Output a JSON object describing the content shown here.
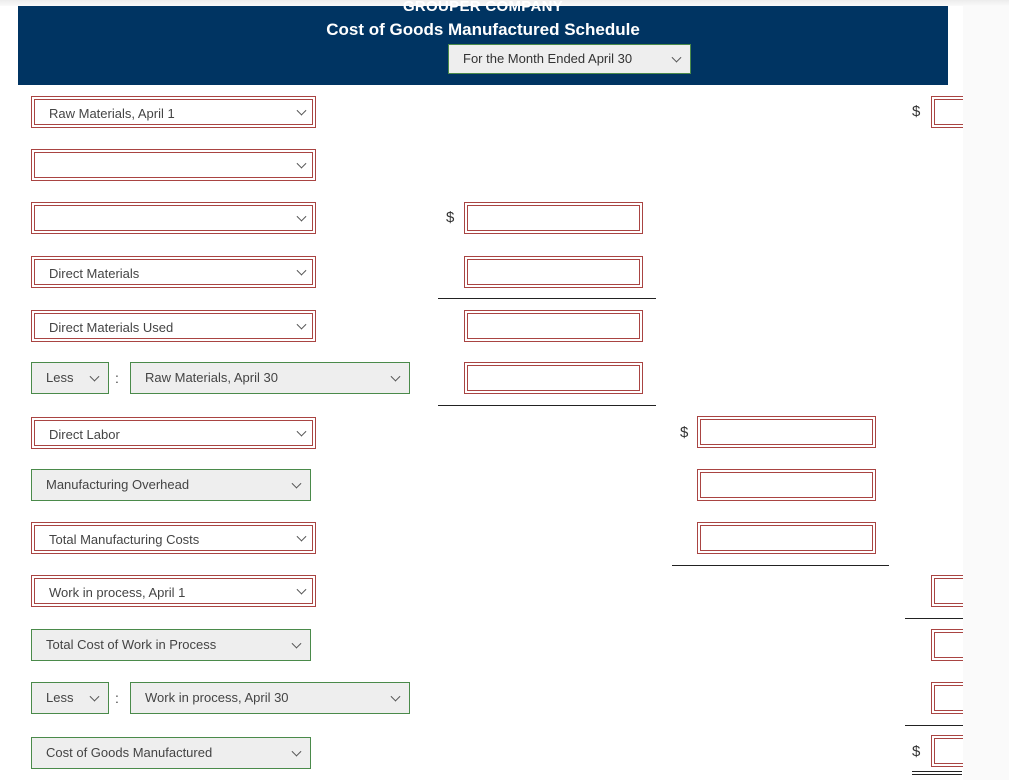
{
  "header": {
    "company": "GROUPER COMPANY",
    "title": "Cost of Goods Manufactured Schedule",
    "period_selected": "For the Month Ended April 30"
  },
  "rows": {
    "r1_label": "Raw Materials, April 1",
    "r2_label": "",
    "r3_label": "",
    "r4_label": "Direct Materials",
    "r5_label": "Direct Materials Used",
    "r6_prefix": "Less",
    "r6_label": "Raw Materials, April 30",
    "r7_label": "Direct Labor",
    "r8_label": "Manufacturing Overhead",
    "r9_label": "Total Manufacturing Costs",
    "r10_label": "Work in process, April 1",
    "r11_label": "Total Cost of Work in Process",
    "r12_prefix": "Less",
    "r12_label": "Work in process, April 30",
    "r13_label": "Cost of Goods Manufactured"
  },
  "symbols": {
    "dollar": "$",
    "colon": ":"
  },
  "inputs": {
    "a1": "",
    "a3": "",
    "a4": "",
    "a5": "",
    "a6": "",
    "b7": "",
    "b8": "",
    "b9": "",
    "c1": "",
    "c10": "",
    "c11": "",
    "c12": "",
    "c13": ""
  }
}
